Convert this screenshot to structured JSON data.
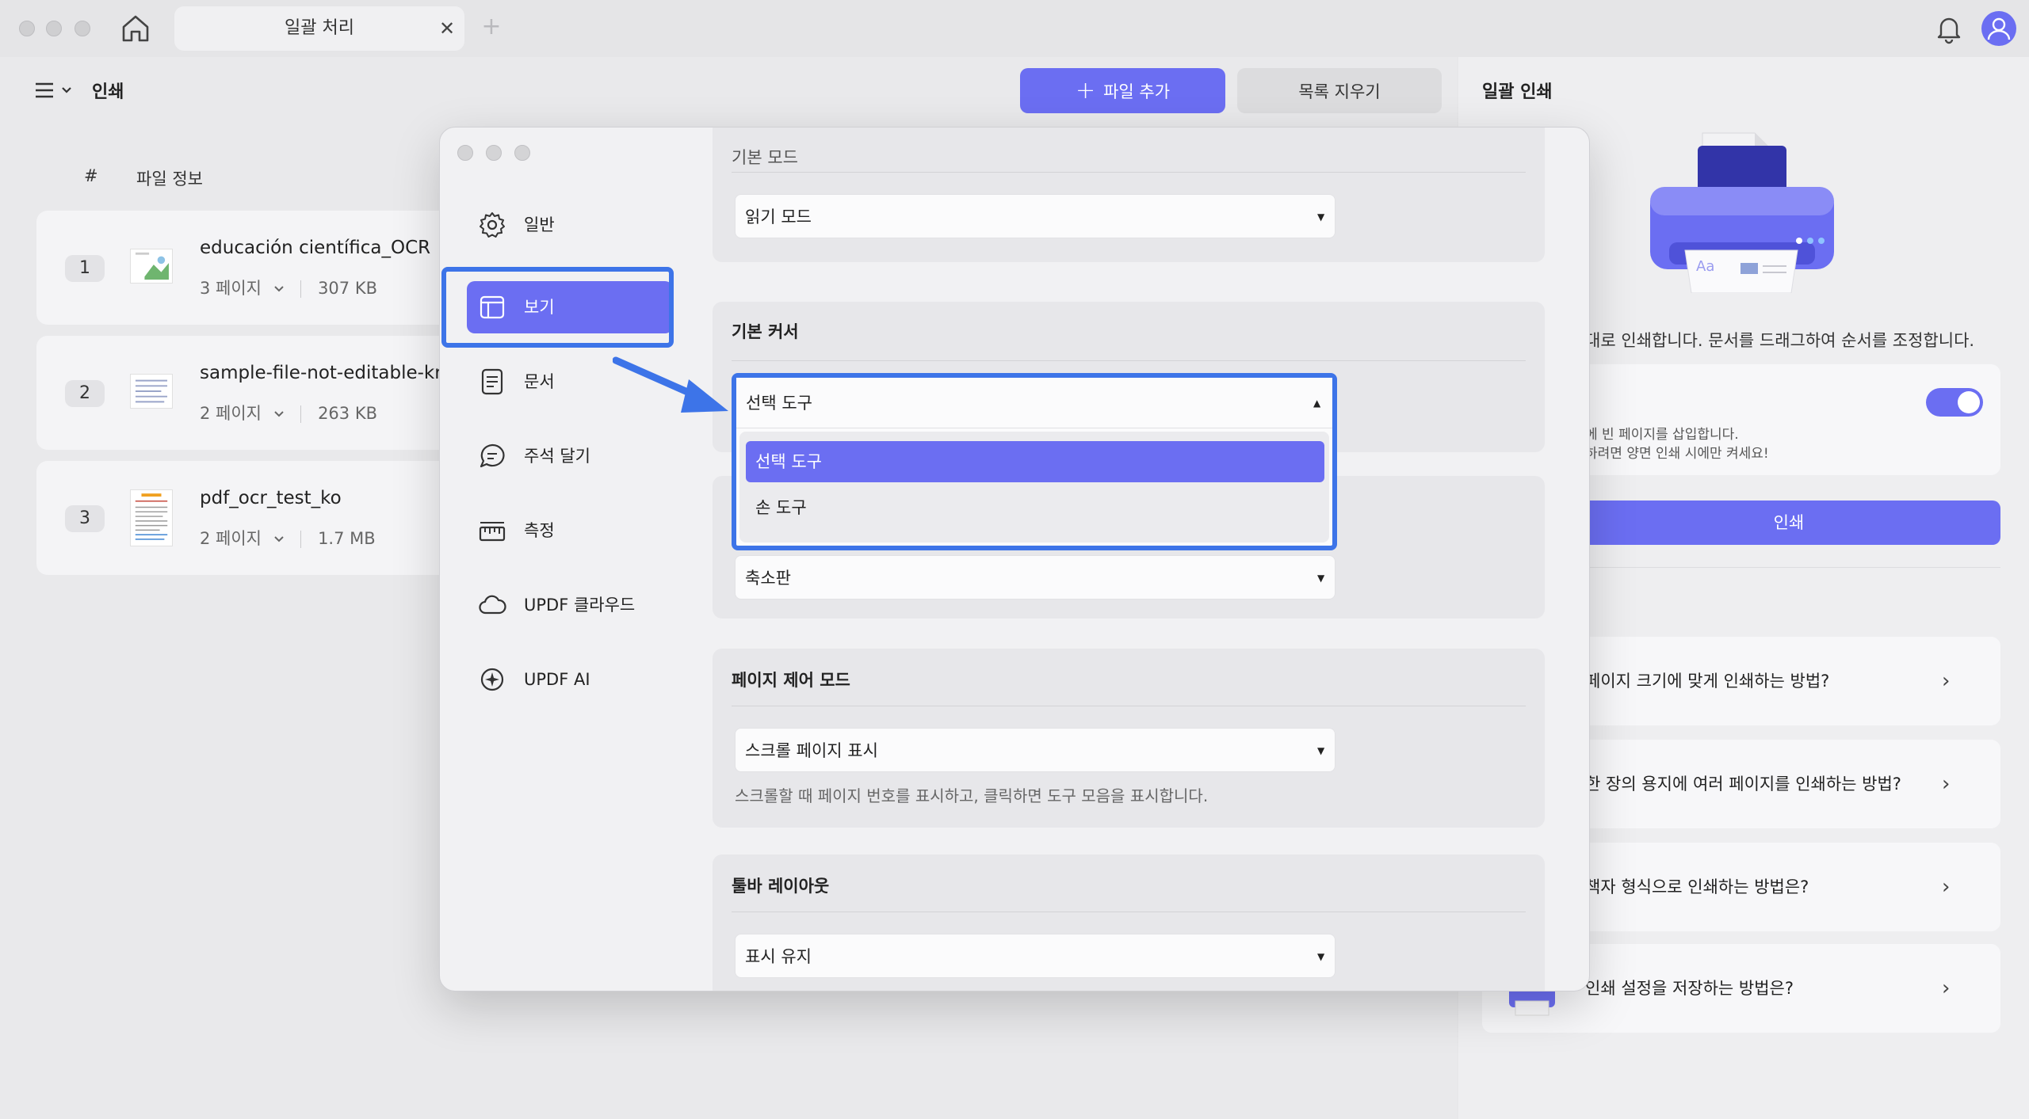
{
  "titlebar": {
    "tab_title": "일괄 처리",
    "tab_close": "✕",
    "tab_plus": "+"
  },
  "left": {
    "breadcrumb": "인쇄",
    "add_file_label": "파일 추가",
    "clear_list_label": "목록 지우기",
    "col_index": "#",
    "col_info": "파일 정보",
    "files": [
      {
        "num": "1",
        "name": "educación científica_OCR",
        "pages": "3 페이지",
        "size": "307 KB"
      },
      {
        "num": "2",
        "name": "sample-file-not-editable-kr",
        "pages": "2 페이지",
        "size": "263 KB"
      },
      {
        "num": "3",
        "name": "pdf_ocr_test_ko",
        "pages": "2 페이지",
        "size": "1.7 MB"
      }
    ]
  },
  "right": {
    "title": "일괄 인쇄",
    "desc": "대로 인쇄합니다. 문서를 드래그하여 순서를 조정합니다.",
    "note1": "에 빈 페이지를 삽입합니다.",
    "note2": "하려면 양면 인쇄 시에만 켜세요!",
    "toggle_on": true,
    "print_label": "인쇄",
    "faqs": [
      "페이지 크기에 맞게 인쇄하는 방법?",
      "한 장의 용지에 여러 페이지를 인쇄하는 방법?",
      "책자 형식으로 인쇄하는 방법은?",
      "인쇄 설정을 저장하는 방법은?"
    ],
    "faq_arrow": "›"
  },
  "modal": {
    "nav": [
      {
        "label": "일반",
        "icon": "gear-icon"
      },
      {
        "label": "보기",
        "icon": "layout-icon"
      },
      {
        "label": "문서",
        "icon": "document-icon"
      },
      {
        "label": "주석 달기",
        "icon": "comment-icon"
      },
      {
        "label": "측정",
        "icon": "ruler-icon"
      },
      {
        "label": "UPDF 클라우드",
        "icon": "cloud-icon"
      },
      {
        "label": "UPDF AI",
        "icon": "ai-icon"
      }
    ],
    "sections": {
      "mode_title": "기본 모드",
      "mode_value": "읽기 모드",
      "cursor_title": "기본 커서",
      "cursor_value": "선택 도구",
      "cursor_options": [
        "선택 도구",
        "손 도구"
      ],
      "zoom_value": "축소판",
      "page_ctrl_title": "페이지 제어 모드",
      "page_ctrl_value": "스크롤 페이지 표시",
      "page_ctrl_hint": "스크롤할 때 페이지 번호를 표시하고, 클릭하면 도구 모음을 표시합니다.",
      "toolbar_title": "툴바 레이아웃",
      "toolbar_value": "표시 유지"
    },
    "caret_down": "▼",
    "caret_up": "▲"
  },
  "colors": {
    "accent": "#6b6ef2",
    "highlight": "#3d74e8"
  }
}
